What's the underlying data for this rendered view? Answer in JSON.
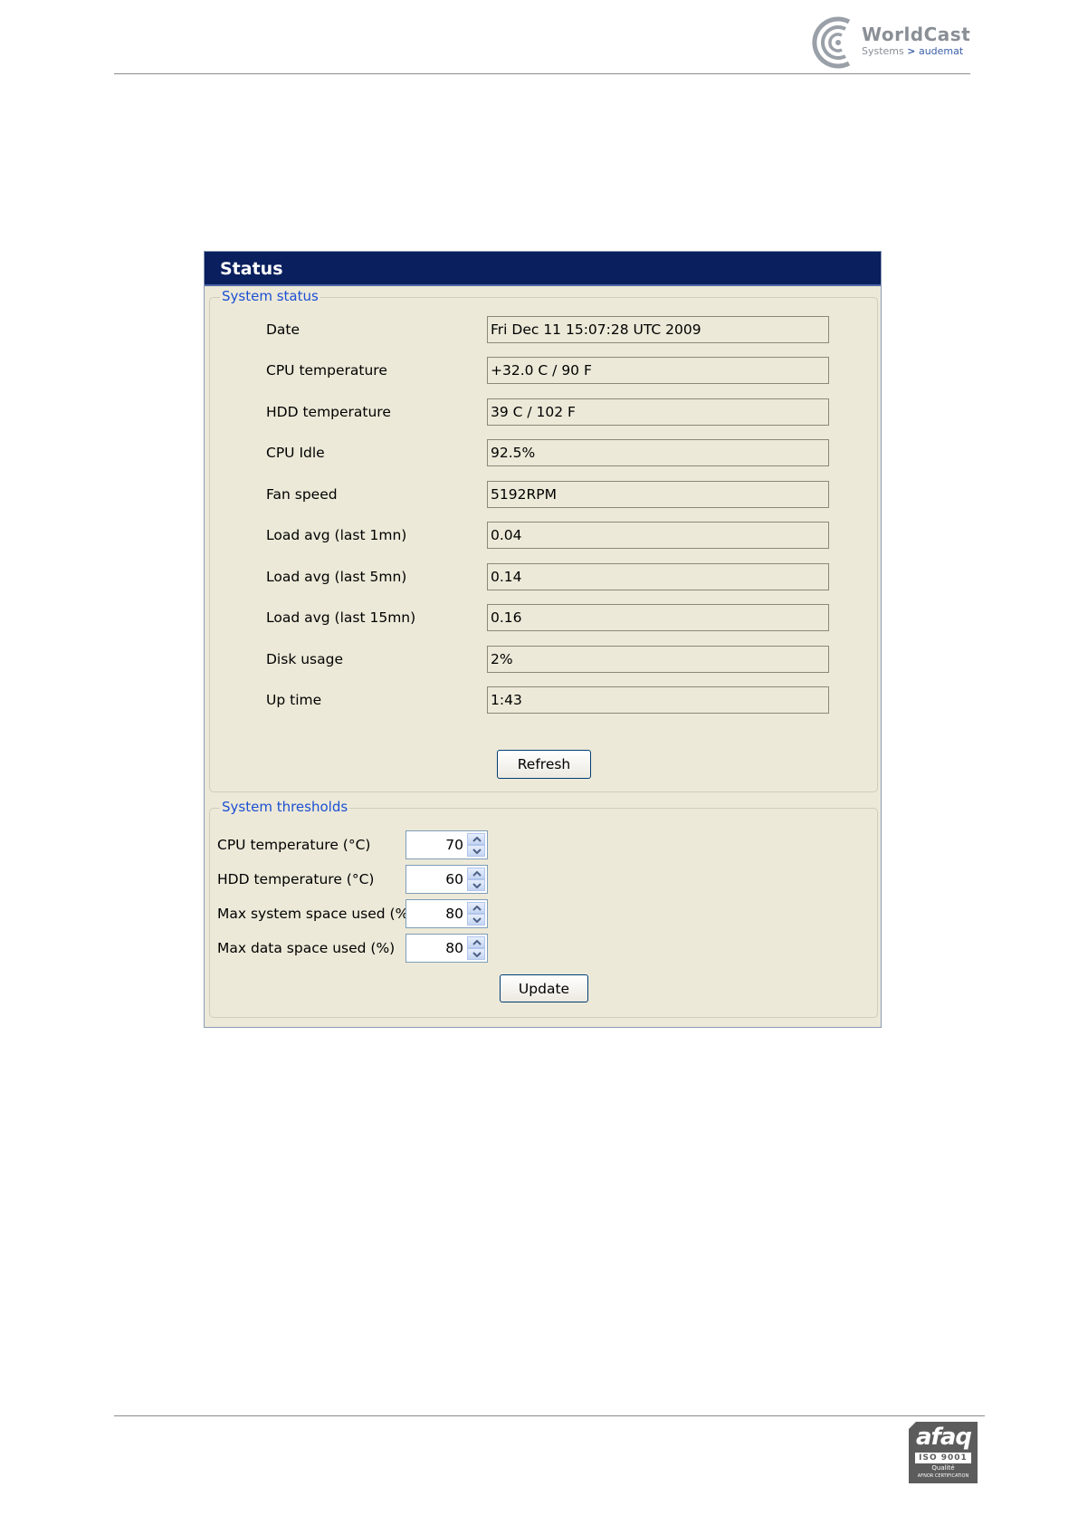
{
  "header": {
    "logo_word": "WorldCast",
    "logo_sub_left": "Systems",
    "logo_sub_sep": ">",
    "logo_sub_right": "audemat"
  },
  "window": {
    "title": "Status"
  },
  "system_status": {
    "title": "System status",
    "rows": [
      {
        "label": "Date",
        "value": "Fri Dec 11 15:07:28 UTC 2009"
      },
      {
        "label": "CPU temperature",
        "value": "+32.0 C  /  90 F"
      },
      {
        "label": "HDD temperature",
        "value": "39 C  /  102 F"
      },
      {
        "label": "CPU Idle",
        "value": "92.5%"
      },
      {
        "label": "Fan speed",
        "value": "5192RPM"
      },
      {
        "label": "Load avg (last 1mn)",
        "value": "0.04"
      },
      {
        "label": "Load avg (last 5mn)",
        "value": "0.14"
      },
      {
        "label": "Load avg (last 15mn)",
        "value": "0.16"
      },
      {
        "label": "Disk usage",
        "value": "2%"
      },
      {
        "label": "Up time",
        "value": " 1:43"
      }
    ],
    "refresh_label": "Refresh"
  },
  "system_thresholds": {
    "title": "System thresholds",
    "rows": [
      {
        "label": "CPU temperature (°C)",
        "value": "70"
      },
      {
        "label": "HDD temperature (°C)",
        "value": "60"
      },
      {
        "label": "Max system space used (%)",
        "value": "80"
      },
      {
        "label": "Max data space used (%)",
        "value": "80"
      }
    ],
    "update_label": "Update"
  },
  "footer": {
    "cert_word": "afaq",
    "cert_iso": "ISO 9001",
    "cert_quality": "Qualité",
    "cert_org": "AFNOR CERTIFICATION"
  },
  "colors": {
    "titlebar": "#0a1f5e",
    "group_title": "#1c50d4",
    "panel_bg": "#ece9d8"
  }
}
